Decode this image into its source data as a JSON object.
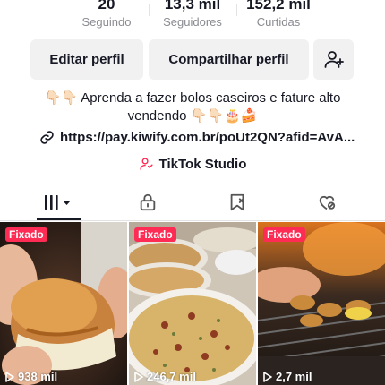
{
  "stats": [
    {
      "value": "20",
      "label": "Seguindo"
    },
    {
      "value": "13,3 mil",
      "label": "Seguidores"
    },
    {
      "value": "152,2 mil",
      "label": "Curtidas"
    }
  ],
  "buttons": {
    "edit": "Editar perfil",
    "share": "Compartilhar perfil",
    "add_friend_icon": "person-plus-icon"
  },
  "bio": {
    "line1": "👇🏻👇🏻 Aprenda a fazer bolos caseiros e fature alto",
    "line2": "vendendo 👇🏻👇🏻🎂🍰"
  },
  "link": {
    "url": "https://pay.kiwify.com.br/poUt2QN?afid=AvA..."
  },
  "studio": {
    "label": "TikTok Studio"
  },
  "tabs": [
    "videos-grid-icon",
    "lock-icon",
    "repost-icon",
    "liked-heart-icon"
  ],
  "videos": [
    {
      "badge": "Fixado",
      "views": "938 mil"
    },
    {
      "badge": "Fixado",
      "views": "246,7 mil"
    },
    {
      "badge": "Fixado",
      "views": "2,7 mil"
    }
  ],
  "colors": {
    "accent": "#fe2c55",
    "text": "#161823",
    "muted": "#8a8b91",
    "button_bg": "#f1f1f2"
  }
}
